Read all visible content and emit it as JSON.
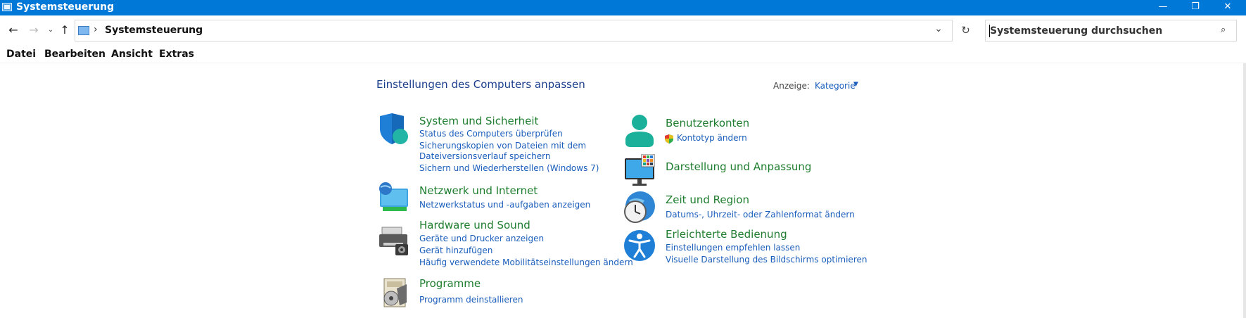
{
  "window": {
    "title": "Systemsteuerung",
    "controls": {
      "minimize": "—",
      "maximize": "❐",
      "close": "✕"
    }
  },
  "address": {
    "breadcrumb_separator": "›",
    "path": "Systemsteuerung",
    "search_placeholder": "Systemsteuerung durchsuchen"
  },
  "menu": [
    "Datei",
    "Bearbeiten",
    "Ansicht",
    "Extras"
  ],
  "content": {
    "heading": "Einstellungen des Computers anpassen",
    "view_label": "Anzeige:",
    "view_value": "Kategorie"
  },
  "categories_left": [
    {
      "title": "System und Sicherheit",
      "icon": "shield-icon",
      "links": [
        "Status des Computers überprüfen",
        "Sicherungskopien von Dateien mit dem",
        "Dateiversionsverlauf speichern",
        "Sichern und Wiederherstellen (Windows 7)"
      ]
    },
    {
      "title": "Netzwerk und Internet",
      "icon": "network-globe-icon",
      "links": [
        "Netzwerkstatus und -aufgaben anzeigen"
      ]
    },
    {
      "title": "Hardware und Sound",
      "icon": "printer-icon",
      "links": [
        "Geräte und Drucker anzeigen",
        "Gerät hinzufügen",
        "Häufig verwendete Mobilitätseinstellungen ändern"
      ]
    },
    {
      "title": "Programme",
      "icon": "programs-icon",
      "links": [
        "Programm deinstallieren"
      ]
    }
  ],
  "categories_right": [
    {
      "title": "Benutzerkonten",
      "icon": "user-accounts-icon",
      "links": [
        "Kontotyp ändern"
      ]
    },
    {
      "title": "Darstellung und Anpassung",
      "icon": "monitor-icon",
      "links": []
    },
    {
      "title": "Zeit und Region",
      "icon": "clock-globe-icon",
      "links": [
        "Datums-, Uhrzeit- oder Zahlenformat ändern"
      ]
    },
    {
      "title": "Erleichterte Bedienung",
      "icon": "accessibility-icon",
      "links": [
        "Einstellungen empfehlen lassen",
        "Visuelle Darstellung des Bildschirms optimieren"
      ]
    }
  ]
}
